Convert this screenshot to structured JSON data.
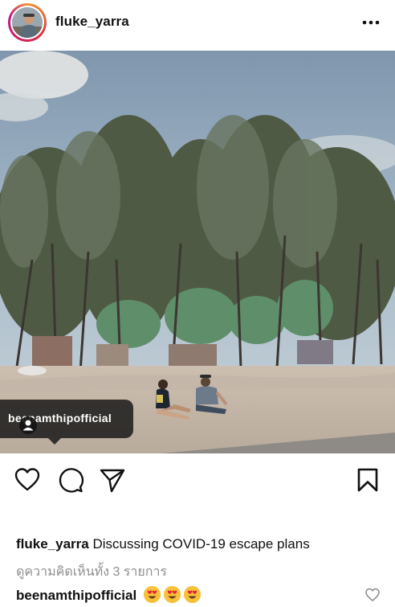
{
  "post": {
    "username": "fluke_yarra",
    "more_icon": "more-horizontal-icon",
    "tag_username": "beenamthipofficial",
    "caption_user": "fluke_yarra",
    "caption_text": " Discussing COVID-19 escape plans",
    "view_comments": "ดูความคิดเห็นทั้ง 3 รายการ",
    "comment_user": "beenamthipofficial",
    "comment_emoji": "heart-eyes-emoji",
    "comment_emoji_count": 3
  },
  "icons": {
    "like": "heart-icon",
    "comment": "comment-bubble-icon",
    "share": "paper-plane-icon",
    "save": "bookmark-icon",
    "comment_like": "heart-outline-icon",
    "tag_person": "person-icon"
  },
  "colors": {
    "text": "#111111",
    "muted": "#8e8e8e",
    "tag_bg": "#1a1a1a",
    "emoji": "#f7c23a"
  }
}
